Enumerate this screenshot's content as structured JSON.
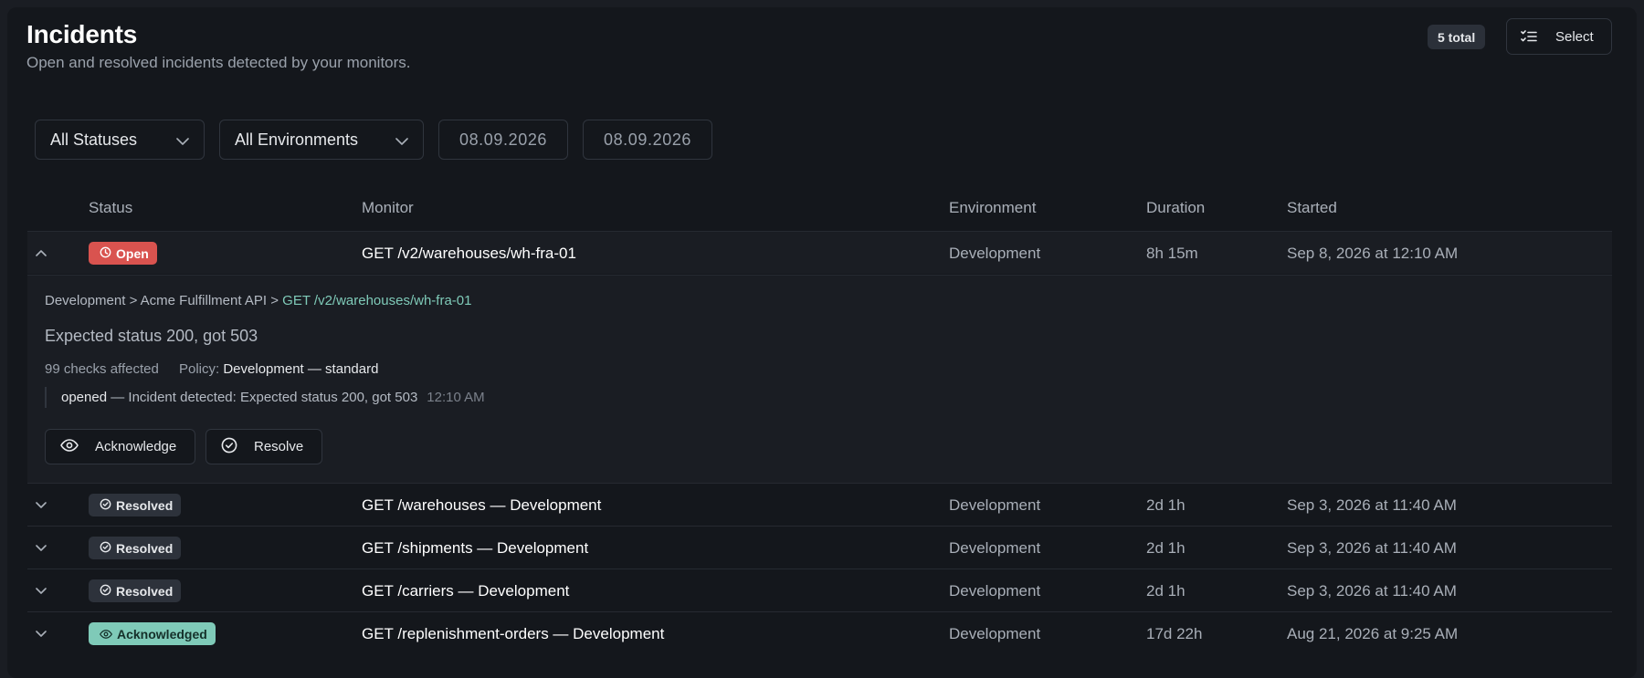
{
  "header": {
    "title": "Incidents",
    "subtitle": "Open and resolved incidents detected by your monitors.",
    "total_badge": "5 total",
    "select_label": "Select"
  },
  "filters": {
    "status": "All Statuses",
    "environment": "All Environments",
    "date_from": "08.09.2026",
    "date_to": "08.09.2026"
  },
  "table": {
    "columns": [
      "Status",
      "Monitor",
      "Environment",
      "Duration",
      "Started"
    ],
    "rows": [
      {
        "status": "Open",
        "status_kind": "open",
        "monitor": "GET /v2/warehouses/wh-fra-01",
        "environment": "Development",
        "duration": "8h 15m",
        "started": "Sep 8, 2026 at 12:10 AM",
        "expanded": true
      },
      {
        "status": "Resolved",
        "status_kind": "resolved",
        "monitor": "GET /warehouses — Development",
        "environment": "Development",
        "duration": "2d 1h",
        "started": "Sep 3, 2026 at 11:40 AM",
        "expanded": false
      },
      {
        "status": "Resolved",
        "status_kind": "resolved",
        "monitor": "GET /shipments — Development",
        "environment": "Development",
        "duration": "2d 1h",
        "started": "Sep 3, 2026 at 11:40 AM",
        "expanded": false
      },
      {
        "status": "Resolved",
        "status_kind": "resolved",
        "monitor": "GET /carriers — Development",
        "environment": "Development",
        "duration": "2d 1h",
        "started": "Sep 3, 2026 at 11:40 AM",
        "expanded": false
      },
      {
        "status": "Acknowledged",
        "status_kind": "acknowledged",
        "monitor": "GET /replenishment-orders — Development",
        "environment": "Development",
        "duration": "17d 22h",
        "started": "Aug 21, 2026 at 9:25 AM",
        "expanded": false
      }
    ]
  },
  "detail": {
    "breadcrumb": {
      "environment": "Development",
      "sep": ">",
      "api": "Acme Fulfillment API",
      "monitor": "GET /v2/warehouses/wh-fra-01"
    },
    "message": "Expected status 200, got 503",
    "checks_affected": "99 checks affected",
    "policy_label": "Policy:",
    "policy_value": "Development — standard",
    "timeline": {
      "event": "opened",
      "text": "— Incident detected: Expected status 200, got 503",
      "time": "12:10 AM"
    },
    "actions": {
      "acknowledge": "Acknowledge",
      "resolve": "Resolve"
    }
  },
  "colors": {
    "open": "#d9534f",
    "resolved": "#2d323b",
    "acknowledged": "#7fcab8",
    "link": "#7fcab8"
  },
  "icons": {
    "select": "checklist-icon",
    "dropdown": "chevron-down-icon",
    "expand": "chevron-down-icon",
    "collapse": "chevron-up-icon",
    "open_badge": "clock-icon",
    "resolved_badge": "check-circle-icon",
    "acknowledged_badge": "eye-icon",
    "acknowledge_action": "eye-icon",
    "resolve_action": "check-circle-icon"
  }
}
